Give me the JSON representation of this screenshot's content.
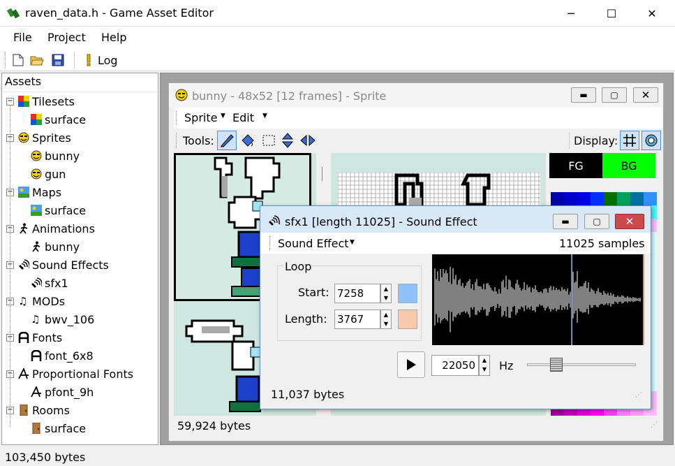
{
  "app": {
    "title": "raven_data.h - Game Asset Editor",
    "window_controls": {
      "minimize": "─",
      "maximize": "☐",
      "close": "✕"
    }
  },
  "menu": {
    "file": "File",
    "project": "Project",
    "help": "Help"
  },
  "toolbar": {
    "log_label": "Log"
  },
  "tree": {
    "header": "Assets",
    "groups": [
      {
        "label": "Tilesets",
        "icon": "tileset-icon",
        "children": [
          "surface"
        ]
      },
      {
        "label": "Sprites",
        "icon": "smiley-icon",
        "children": [
          "bunny",
          "gun"
        ]
      },
      {
        "label": "Maps",
        "icon": "map-icon",
        "children": [
          "surface"
        ]
      },
      {
        "label": "Animations",
        "icon": "running-man-icon",
        "children": [
          "bunny"
        ]
      },
      {
        "label": "Sound Effects",
        "icon": "speaker-icon",
        "children": [
          "sfx1"
        ]
      },
      {
        "label": "MODs",
        "icon": "music-note-icon",
        "children": [
          "bwv_106"
        ]
      },
      {
        "label": "Fonts",
        "icon": "font-icon",
        "children": [
          "font_6x8"
        ]
      },
      {
        "label": "Proportional Fonts",
        "icon": "prop-font-icon",
        "children": [
          "pfont_9h"
        ]
      },
      {
        "label": "Rooms",
        "icon": "door-icon",
        "children": [
          "surface"
        ]
      }
    ]
  },
  "sprite_window": {
    "title": "bunny - 48x52 [12 frames] - Sprite",
    "menu_sprite": "Sprite",
    "menu_edit": "Edit",
    "tools_label": "Tools:",
    "display_label": "Display:",
    "fg_label": "FG",
    "bg_label": "BG",
    "status": "59,924 bytes",
    "colors": {
      "fg": "#000000",
      "bg": "#00ff00"
    }
  },
  "sound_window": {
    "title": "sfx1 [length 11025] - Sound Effect",
    "menu": "Sound Effect",
    "samples_count": "11025",
    "samples_label": "samples",
    "loop_label": "Loop",
    "start_label": "Start:",
    "start_value": "7258",
    "length_label": "Length:",
    "length_value": "3767",
    "rate_value": "22050",
    "rate_unit": "Hz",
    "rate_slider_position": 0.24,
    "status": "11,037 bytes",
    "colors": {
      "start_swatch": "#8fc3f7",
      "length_swatch": "#f9c9ab"
    }
  },
  "status": {
    "total": "103,450 bytes"
  }
}
